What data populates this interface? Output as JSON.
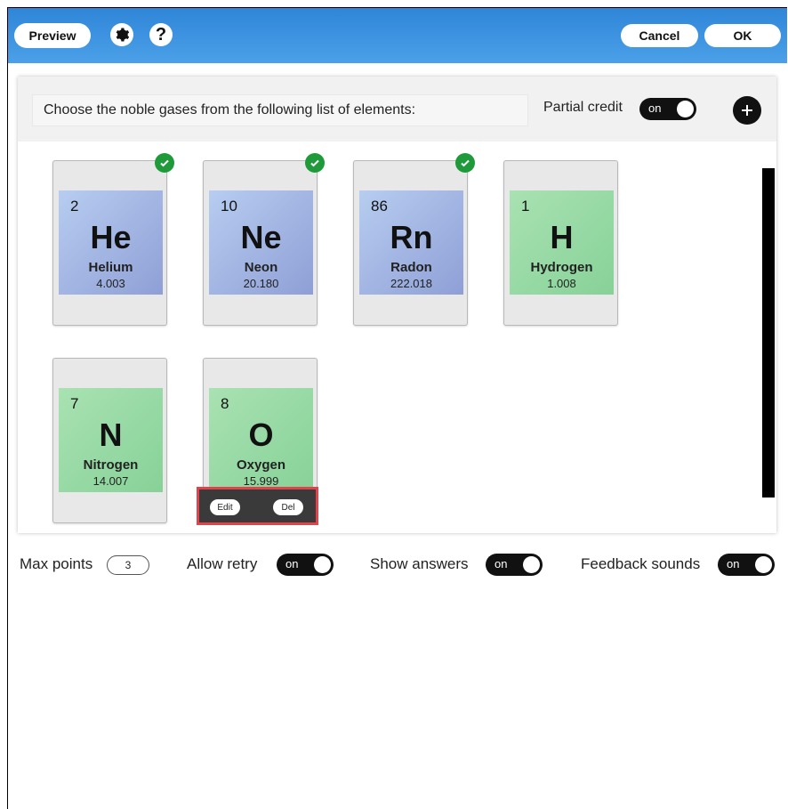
{
  "toolbar": {
    "preview_label": "Preview",
    "settings_icon": "gear-icon",
    "help_label": "?",
    "cancel_label": "Cancel",
    "ok_label": "OK"
  },
  "question": {
    "prompt": "Choose the noble gases from the following list of elements:",
    "partial_credit_label": "Partial credit",
    "partial_credit_state": "on",
    "add_icon": "plus-icon"
  },
  "elements": [
    {
      "number": "2",
      "symbol": "He",
      "name": "Helium",
      "mass": "4.003",
      "group": "noble",
      "correct": true
    },
    {
      "number": "10",
      "symbol": "Ne",
      "name": "Neon",
      "mass": "20.180",
      "group": "noble",
      "correct": true
    },
    {
      "number": "86",
      "symbol": "Rn",
      "name": "Radon",
      "mass": "222.018",
      "group": "noble",
      "correct": true
    },
    {
      "number": "1",
      "symbol": "H",
      "name": "Hydrogen",
      "mass": "1.008",
      "group": "other",
      "correct": false
    },
    {
      "number": "7",
      "symbol": "N",
      "name": "Nitrogen",
      "mass": "14.007",
      "group": "other",
      "correct": false
    },
    {
      "number": "8",
      "symbol": "O",
      "name": "Oxygen",
      "mass": "15.999",
      "group": "other",
      "correct": false
    }
  ],
  "item_actions": {
    "edit_label": "Edit",
    "delete_label": "Del"
  },
  "settings": {
    "max_points_label": "Max points",
    "max_points_value": "3",
    "allow_retry_label": "Allow retry",
    "allow_retry_state": "on",
    "show_answers_label": "Show answers",
    "show_answers_state": "on",
    "feedback_sounds_label": "Feedback sounds",
    "feedback_sounds_state": "on"
  },
  "colors": {
    "header_blue": "#3a93df",
    "noble_tile": "#a3b4e3",
    "other_tile": "#98d9a5",
    "check_green": "#1f9a3a",
    "highlight_red": "#e0434b"
  }
}
